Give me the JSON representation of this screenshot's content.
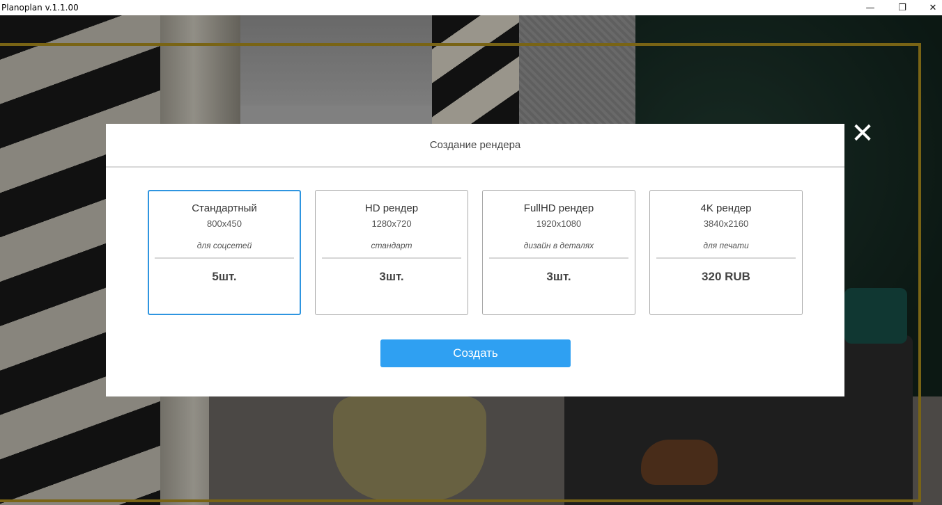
{
  "window": {
    "title": "Planoplan v.1.1.00",
    "minimize_glyph": "—",
    "maximize_glyph": "❐",
    "close_glyph": "✕"
  },
  "modal": {
    "title": "Создание рендера",
    "close_glyph": "✕",
    "create_label": "Создать",
    "accent_color": "#2fa0f2",
    "options": [
      {
        "name": "Стандартный",
        "resolution": "800x450",
        "description": "для соцсетей",
        "price": "5шт.",
        "selected": true
      },
      {
        "name": "HD рендер",
        "resolution": "1280x720",
        "description": "стандарт",
        "price": "3шт.",
        "selected": false
      },
      {
        "name": "FullHD рендер",
        "resolution": "1920x1080",
        "description": "дизайн в деталях",
        "price": "3шт.",
        "selected": false
      },
      {
        "name": "4K рендер",
        "resolution": "3840x2160",
        "description": "для печати",
        "price": "320 RUB",
        "selected": false
      }
    ]
  }
}
